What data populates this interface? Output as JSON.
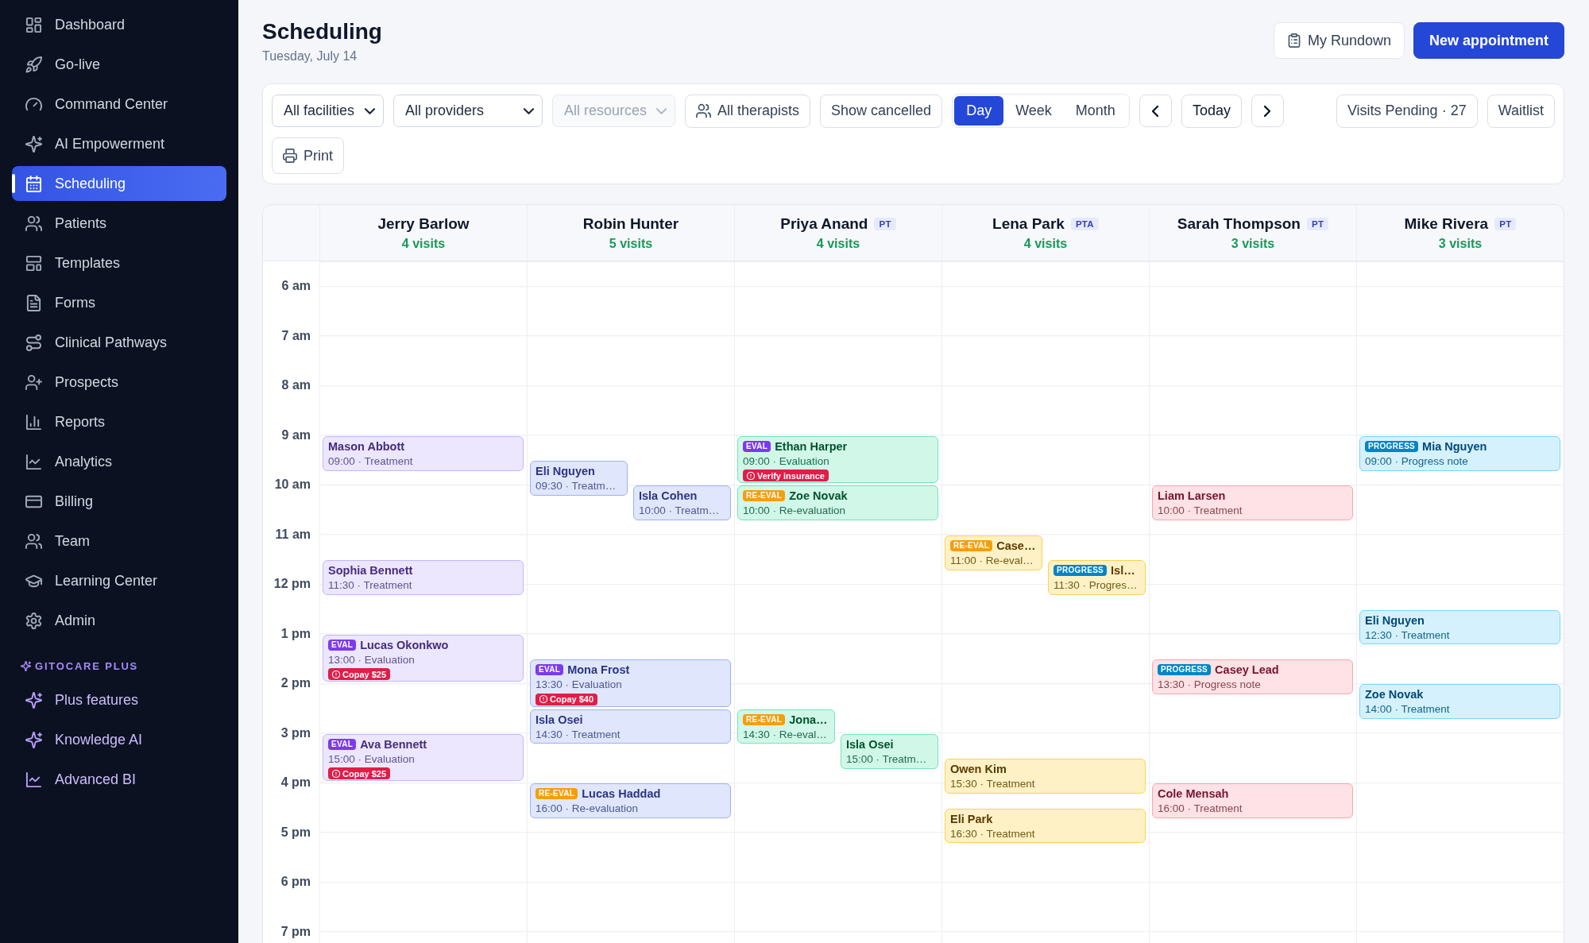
{
  "sidebar": {
    "items": [
      {
        "label": "Dashboard",
        "selected": false
      },
      {
        "label": "Go-live",
        "selected": false
      },
      {
        "label": "Command Center",
        "selected": false
      },
      {
        "label": "AI Empowerment",
        "selected": false
      },
      {
        "label": "Scheduling",
        "selected": true
      },
      {
        "label": "Patients",
        "selected": false
      },
      {
        "label": "Templates",
        "selected": false
      },
      {
        "label": "Forms",
        "selected": false
      },
      {
        "label": "Clinical Pathways",
        "selected": false
      },
      {
        "label": "Prospects",
        "selected": false
      },
      {
        "label": "Reports",
        "selected": false
      },
      {
        "label": "Analytics",
        "selected": false
      },
      {
        "label": "Billing",
        "selected": false
      },
      {
        "label": "Team",
        "selected": false
      },
      {
        "label": "Learning Center",
        "selected": false
      },
      {
        "label": "Admin",
        "selected": false
      }
    ],
    "section": {
      "title": "GITOCARE PLUS",
      "items": [
        {
          "label": "Plus features",
          "selected": false
        },
        {
          "label": "Knowledge AI",
          "selected": false
        },
        {
          "label": "Advanced BI",
          "selected": false
        }
      ]
    }
  },
  "header": {
    "title": "Scheduling",
    "date": "Tuesday, July 14",
    "actions": [
      {
        "label": "My Rundown",
        "kind": "secondary"
      },
      {
        "label": "New appointment",
        "kind": "primary"
      }
    ]
  },
  "toolbar": {
    "filters": [
      {
        "label": "All facilities",
        "disabled": false
      },
      {
        "label": "All providers",
        "disabled": false
      },
      {
        "label": "All resources",
        "disabled": true
      }
    ],
    "buttons": [
      {
        "label": "All therapists"
      },
      {
        "label": "Show cancelled"
      }
    ],
    "views": [
      {
        "label": "Day",
        "selected": true
      },
      {
        "label": "Week",
        "selected": false
      },
      {
        "label": "Month",
        "selected": false
      }
    ],
    "today": "Today",
    "pending": "Visits Pending · 27",
    "waitlist": "Waitlist",
    "print": "Print"
  },
  "calendar": {
    "hours": [
      "6 am",
      "7 am",
      "8 am",
      "9 am",
      "10 am",
      "11 am",
      "12 pm",
      "1 pm",
      "2 pm",
      "3 pm",
      "4 pm",
      "5 pm",
      "6 pm",
      "7 pm"
    ],
    "providers": [
      {
        "name": "Jerry Barlow",
        "visits": "4 visits",
        "color": "#c4b5fd",
        "appointments": [
          {
            "patient": "Mason Abbott",
            "detail": "09:00 · Treatment"
          },
          {
            "patient": "Sophia Bennett",
            "detail": "11:30 · Treatment"
          },
          {
            "tag": {
              "kind": "eval",
              "label": "EVAL"
            },
            "patient": "Lucas Okonkwo",
            "detail": "13:00 · Evaluation",
            "flag": "Copay $25"
          },
          {
            "tag": {
              "kind": "eval",
              "label": "EVAL"
            },
            "patient": "Ava Bennett",
            "detail": "15:00 · Evaluation",
            "flag": "Copay $25"
          }
        ]
      },
      {
        "name": "Robin Hunter",
        "visits": "5 visits",
        "color": "#9fb0f5",
        "appointments": [
          {
            "patient": "Eli Nguyen",
            "detail": "09:30 · Treatm…"
          },
          {
            "patient": "Isla Cohen",
            "detail": "10:00 · Treatm…"
          },
          {
            "tag": {
              "kind": "eval",
              "label": "EVAL"
            },
            "patient": "Mona Frost",
            "detail": "13:30 · Evaluation",
            "flag": "Copay $40"
          },
          {
            "patient": "Isla Osei",
            "detail": "14:30 · Treatment"
          },
          {
            "tag": {
              "kind": "reeval",
              "label": "RE-EVAL"
            },
            "patient": "Lucas Haddad",
            "detail": "16:00 · Re-evaluation"
          }
        ]
      },
      {
        "name": "Priya Anand",
        "role": "PT",
        "visits": "4 visits",
        "color": "#6ee7b7",
        "appointments": [
          {
            "tag": {
              "kind": "eval",
              "label": "EVAL"
            },
            "patient": "Ethan Harper",
            "detail": "09:00 · Evaluation",
            "flag": "Verify insurance"
          },
          {
            "tag": {
              "kind": "reeval",
              "label": "RE-EVAL"
            },
            "patient": "Zoe Novak",
            "detail": "10:00 · Re-evaluation"
          },
          {
            "tag": {
              "kind": "reeval",
              "label": "RE-EVAL"
            },
            "patient": "Jona…",
            "detail": "14:30 · Re-eval…"
          },
          {
            "patient": "Isla Osei",
            "detail": "15:00 · Treatm…"
          }
        ]
      },
      {
        "name": "Lena Park",
        "role": "PTA",
        "visits": "4 visits",
        "color": "#fcd34d",
        "appointments": [
          {
            "tag": {
              "kind": "reeval",
              "label": "RE-EVAL"
            },
            "patient": "Case…",
            "detail": "11:00 · Re-eval…"
          },
          {
            "tag": {
              "kind": "progress",
              "label": "PROGRESS"
            },
            "patient": "Isl…",
            "detail": "11:30 · Progres…"
          },
          {
            "patient": "Owen Kim",
            "detail": "15:30 · Treatment"
          },
          {
            "patient": "Eli Park",
            "detail": "16:30 · Treatment"
          }
        ]
      },
      {
        "name": "Sarah Thompson",
        "role": "PT",
        "visits": "3 visits",
        "color": "#fda4af",
        "appointments": [
          {
            "patient": "Liam Larsen",
            "detail": "10:00 · Treatment"
          },
          {
            "tag": {
              "kind": "progress",
              "label": "PROGRESS"
            },
            "patient": "Casey Lead",
            "detail": "13:30 · Progress note"
          },
          {
            "patient": "Cole Mensah",
            "detail": "16:00 · Treatment"
          }
        ]
      },
      {
        "name": "Mike Rivera",
        "role": "PT",
        "visits": "3 visits",
        "color": "#7dd3fc",
        "appointments": [
          {
            "tag": {
              "kind": "progress",
              "label": "PROGRESS"
            },
            "patient": "Mia Nguyen",
            "detail": "09:00 · Progress note"
          },
          {
            "patient": "Eli Nguyen",
            "detail": "12:30 · Treatment"
          },
          {
            "patient": "Zoe Novak",
            "detail": "14:00 · Treatment"
          }
        ]
      }
    ]
  }
}
